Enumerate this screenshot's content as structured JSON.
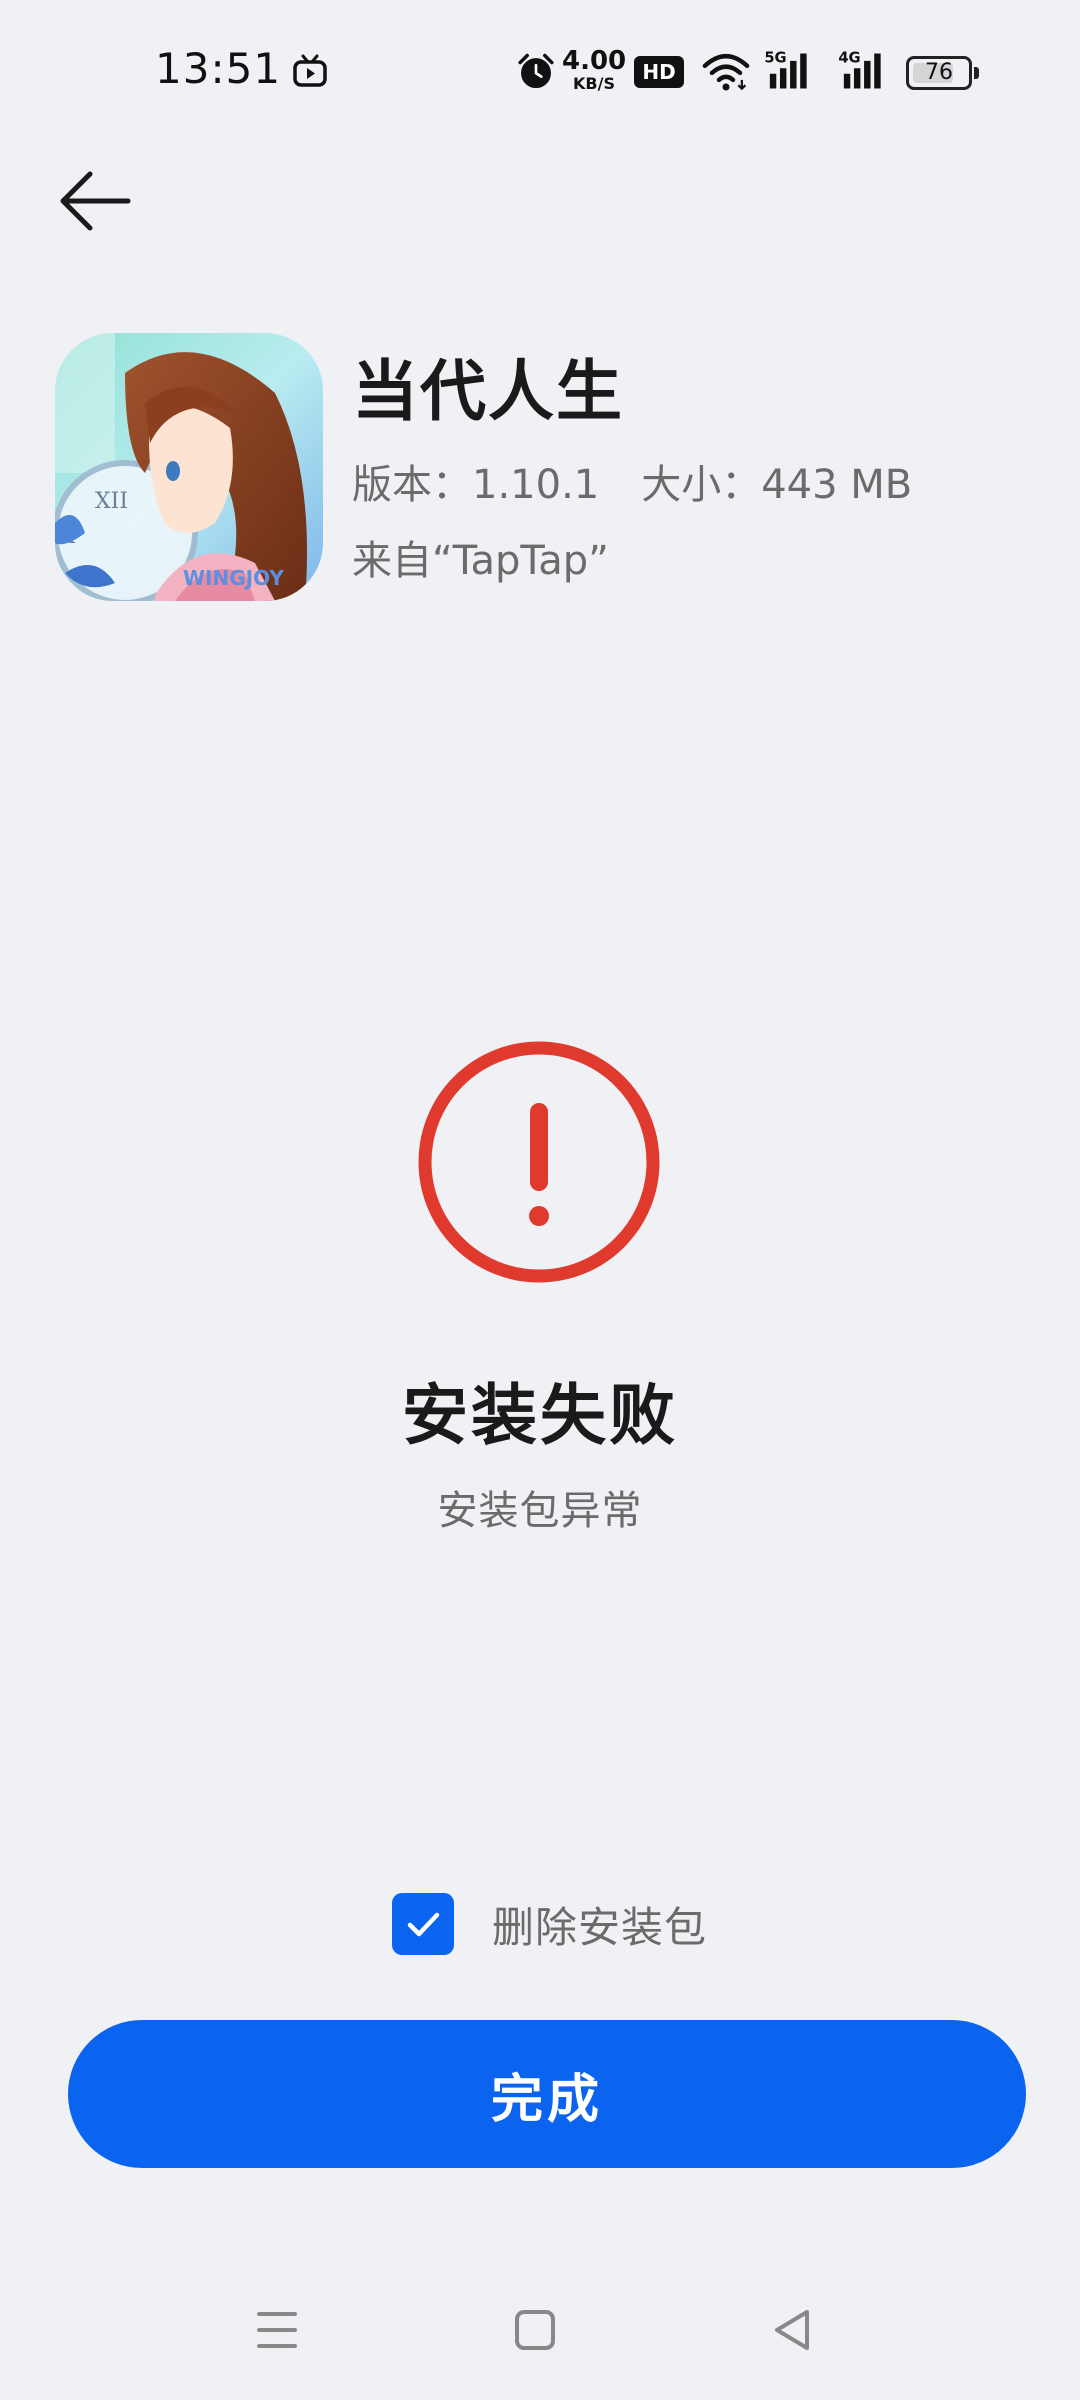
{
  "status_bar": {
    "time": "13:51",
    "net_speed_value": "4.00",
    "net_speed_unit": "KB/S",
    "hd_badge": "HD",
    "signal_5g": "5G",
    "signal_4g": "4G",
    "battery_level": "76",
    "battery_fraction": 0.76,
    "icons": [
      "tv-icon",
      "alarm-icon",
      "wifi-icon",
      "signal-5g-icon",
      "signal-4g-icon",
      "battery-icon"
    ]
  },
  "header": {
    "back_icon": "arrow-left-icon"
  },
  "app": {
    "name": "当代人生",
    "version_label": "版本：",
    "version": "1.10.1",
    "size_label": "大小：",
    "size": "443 MB",
    "source": "来自“TapTap”",
    "icon_watermark": "WINGJOY"
  },
  "result": {
    "icon": "error-exclamation-icon",
    "title": "安装失败",
    "detail": "安装包异常"
  },
  "delete_package": {
    "label": "删除安装包",
    "checked": true
  },
  "done_button": {
    "label": "完成"
  },
  "nav_bar": {
    "icons": [
      "menu-icon",
      "home-icon",
      "back-triangle-icon"
    ]
  },
  "colors": {
    "background": "#f0f1f4",
    "accent": "#0a64f0",
    "error": "#e03a2f",
    "text_primary": "#1a1a1a",
    "text_secondary": "#6b6b6b"
  }
}
